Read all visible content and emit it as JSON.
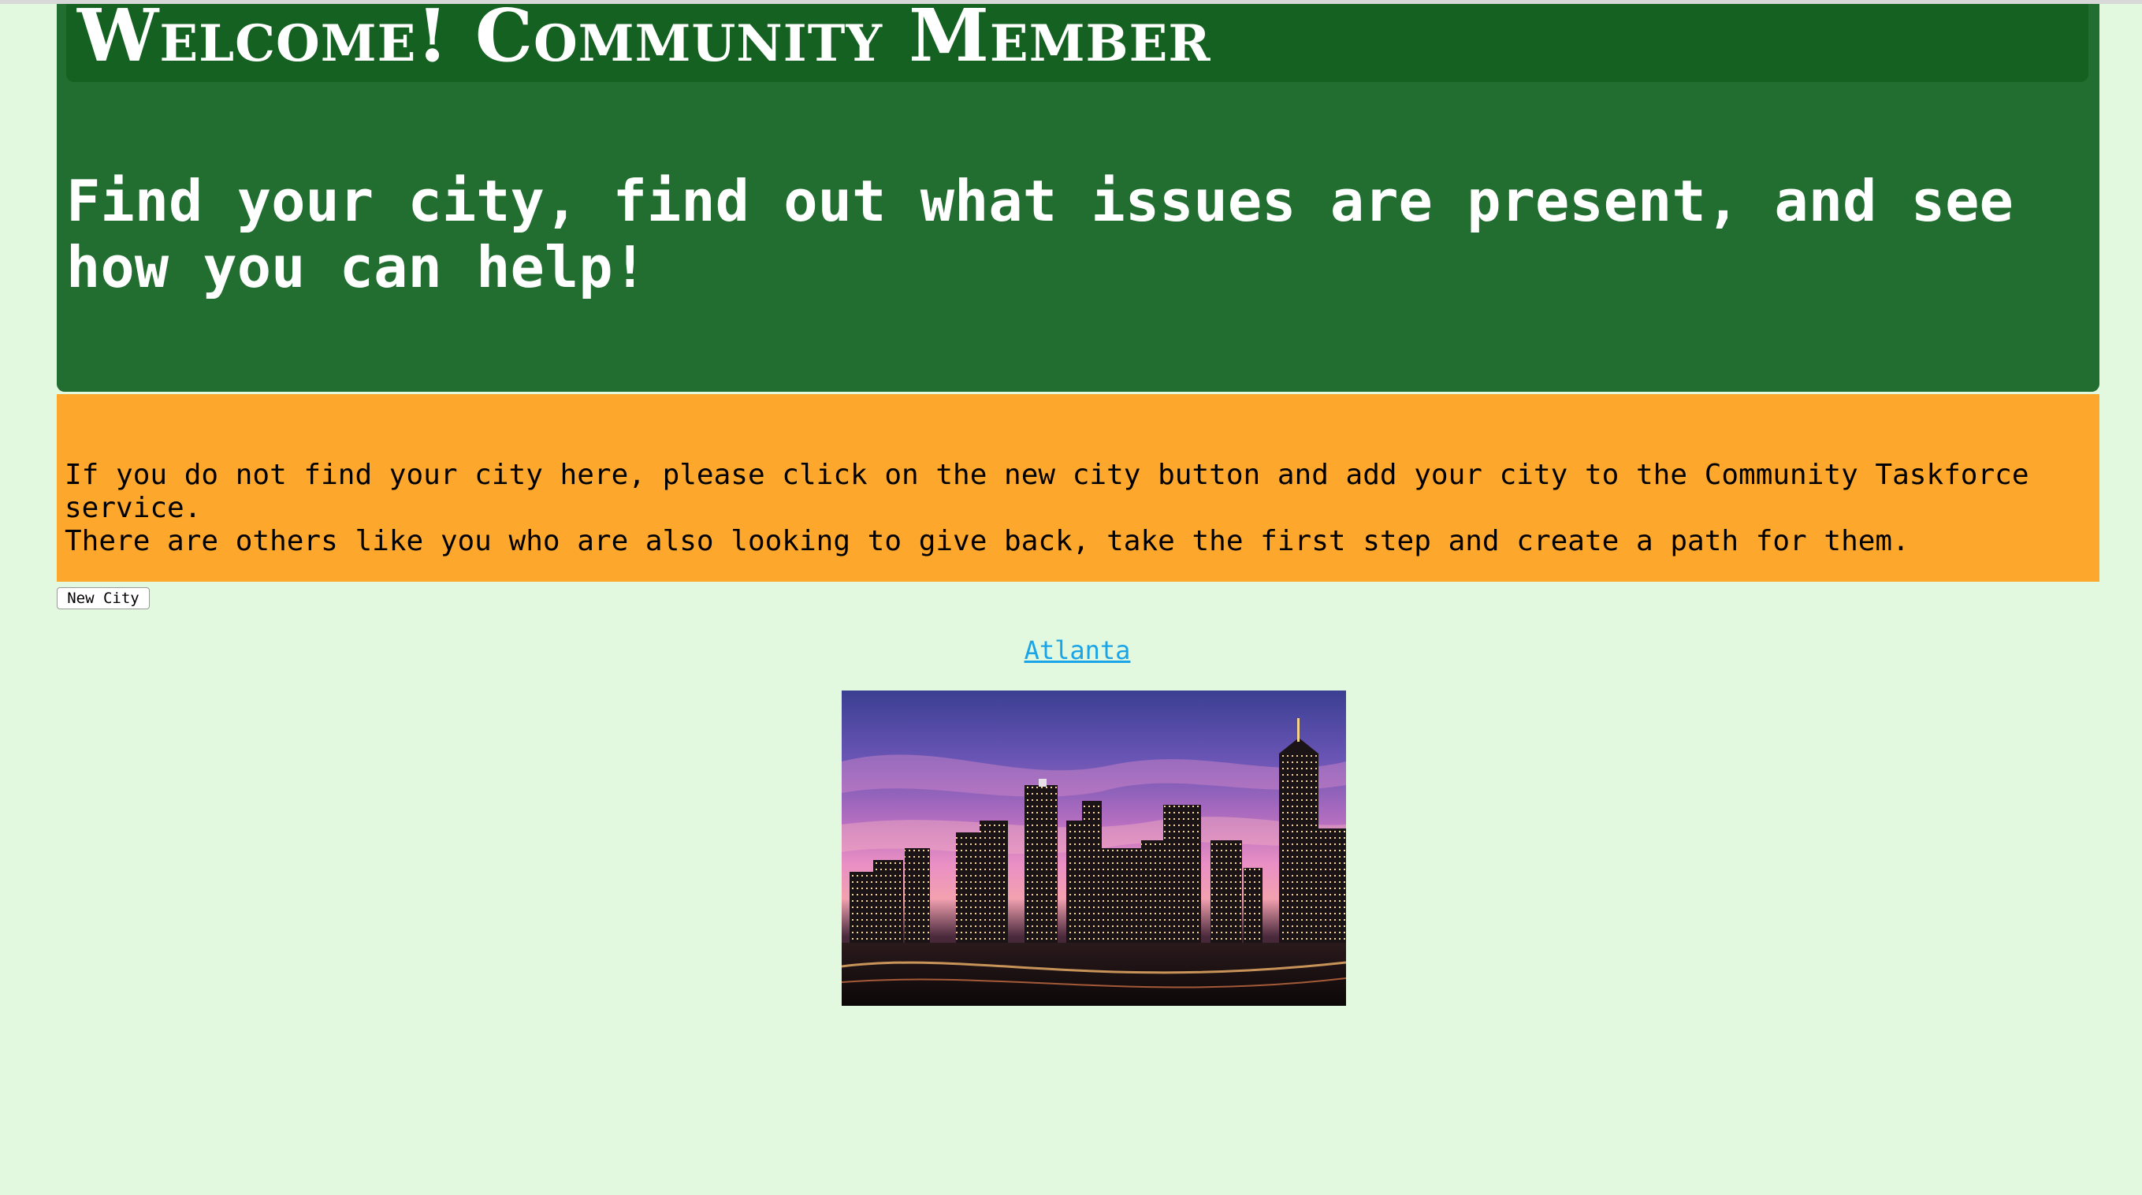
{
  "header": {
    "title": "Welcome! Community Member",
    "tagline": "Find your city, find out what issues are present, and see how you can help!"
  },
  "notice": {
    "text": "If you do not find your city here, please click on the new city button and add your city to the Community Taskforce service.\nThere are others like you who are also looking to give back, take the first step and create a path for them."
  },
  "toolbar": {
    "new_city_label": "New City"
  },
  "cities": [
    {
      "name": "Atlanta",
      "image_subject": "atlanta-skyline-at-dusk"
    }
  ],
  "colors": {
    "page_background": "#e2f8df",
    "hero_background": "#216e30",
    "title_bar": "#156122",
    "notice_background": "#fda72d",
    "link": "#1aa5e8"
  }
}
